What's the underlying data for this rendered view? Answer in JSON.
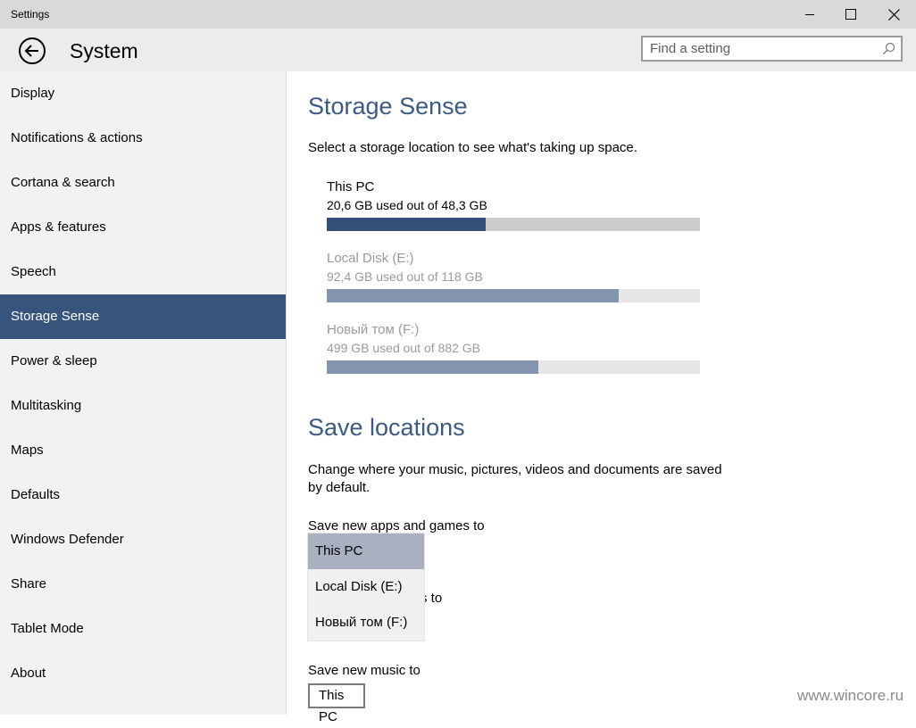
{
  "window": {
    "title": "Settings"
  },
  "header": {
    "title": "System",
    "search": {
      "placeholder": "Find a setting",
      "value": ""
    }
  },
  "sidebar": {
    "items": [
      {
        "label": "Display"
      },
      {
        "label": "Notifications & actions"
      },
      {
        "label": "Cortana & search"
      },
      {
        "label": "Apps & features"
      },
      {
        "label": "Speech"
      },
      {
        "label": "Storage Sense",
        "selected": true
      },
      {
        "label": "Power & sleep"
      },
      {
        "label": "Multitasking"
      },
      {
        "label": "Maps"
      },
      {
        "label": "Defaults"
      },
      {
        "label": "Windows Defender"
      },
      {
        "label": "Share"
      },
      {
        "label": "Tablet Mode"
      },
      {
        "label": "About"
      }
    ]
  },
  "storage": {
    "heading": "Storage Sense",
    "description": "Select a storage location to see what's taking up space.",
    "drives": [
      {
        "name": "This PC",
        "usage": "20,6 GB used out of 48,3 GB",
        "used_fraction": 0.427,
        "fill_color": "#34507a",
        "track_color": "#cccccc",
        "dim": false
      },
      {
        "name": "Local Disk (E:)",
        "usage": "92,4 GB used out of 118 GB",
        "used_fraction": 0.783,
        "fill_color": "#8294ae",
        "track_color": "#e6e6e6",
        "dim": true
      },
      {
        "name": "Новый том (F:)",
        "usage": "499 GB used out of 882 GB",
        "used_fraction": 0.566,
        "fill_color": "#8294ae",
        "track_color": "#e6e6e6",
        "dim": true
      }
    ]
  },
  "save_locations": {
    "heading": "Save locations",
    "description_line1": "Change where your music, pictures, videos and documents are saved",
    "description_line2": "by default.",
    "apps_label": "Save new apps and games to",
    "hidden_label_tail": "s to",
    "dropdown_options": [
      {
        "label": "This PC",
        "selected": true
      },
      {
        "label": "Local Disk (E:)"
      },
      {
        "label": "Новый том (F:)"
      }
    ],
    "music_label": "Save new music to",
    "music_value": "This PC"
  },
  "watermark": "www.wincore.ru",
  "colors": {
    "accent": "#36547c",
    "heading": "#3d5a80"
  }
}
